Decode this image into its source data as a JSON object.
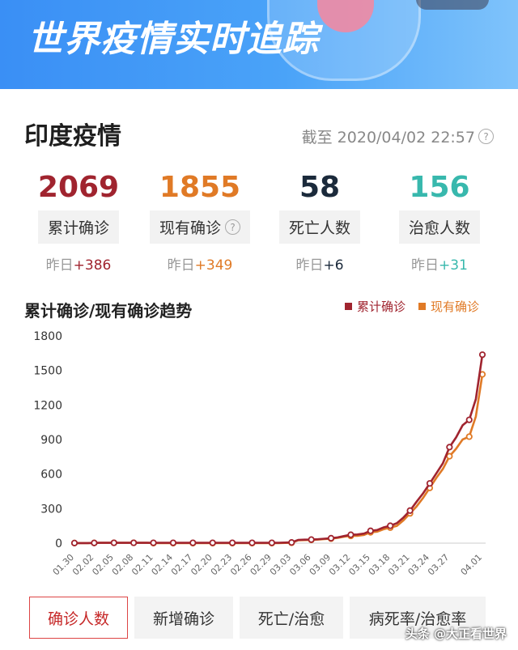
{
  "header": {
    "banner_title": "世界疫情实时追踪"
  },
  "section": {
    "title": "印度疫情",
    "as_of": "截至 2020/04/02 22:57",
    "help_glyph": "?"
  },
  "stats": [
    {
      "value": "2069",
      "label": "累计确诊",
      "delta_label": "昨日",
      "delta": "+386",
      "color": "#a0242f",
      "delta_color": "#a0242f",
      "help": false
    },
    {
      "value": "1855",
      "label": "现有确诊",
      "delta_label": "昨日",
      "delta": "+349",
      "color": "#e07a26",
      "delta_color": "#e07a26",
      "help": true
    },
    {
      "value": "58",
      "label": "死亡人数",
      "delta_label": "昨日",
      "delta": "+6",
      "color": "#1b2a3b",
      "delta_color": "#1b2a3b",
      "help": false
    },
    {
      "value": "156",
      "label": "治愈人数",
      "delta_label": "昨日",
      "delta": "+31",
      "color": "#38b8ad",
      "delta_color": "#38b8ad",
      "help": false
    }
  ],
  "chart_section": {
    "title": "累计确诊/现有确诊趋势",
    "legend": [
      {
        "name": "累计确诊",
        "color": "#a0242f"
      },
      {
        "name": "现有确诊",
        "color": "#e07a26"
      }
    ]
  },
  "chart_data": {
    "type": "line",
    "title": "累计确诊/现有确诊趋势",
    "xlabel": "",
    "ylabel": "",
    "ylim": [
      0,
      1800
    ],
    "yticks": [
      0,
      300,
      600,
      900,
      1200,
      1500,
      1800
    ],
    "grid": false,
    "legend_position": "top-right",
    "x": [
      "01.30",
      "01.31",
      "02.01",
      "02.02",
      "02.03",
      "02.04",
      "02.05",
      "02.06",
      "02.07",
      "02.08",
      "02.09",
      "02.10",
      "02.11",
      "02.12",
      "02.13",
      "02.14",
      "02.15",
      "02.16",
      "02.17",
      "02.18",
      "02.19",
      "02.20",
      "02.21",
      "02.22",
      "02.23",
      "02.24",
      "02.25",
      "02.26",
      "02.27",
      "02.28",
      "02.29",
      "03.01",
      "03.02",
      "03.03",
      "03.04",
      "03.05",
      "03.06",
      "03.07",
      "03.08",
      "03.09",
      "03.10",
      "03.11",
      "03.12",
      "03.13",
      "03.14",
      "03.15",
      "03.16",
      "03.17",
      "03.18",
      "03.19",
      "03.20",
      "03.21",
      "03.22",
      "03.23",
      "03.24",
      "03.25",
      "03.26",
      "03.27",
      "03.28",
      "03.29",
      "03.30",
      "03.31",
      "04.01"
    ],
    "tick_labels": [
      "01.30",
      "02.02",
      "02.05",
      "02.08",
      "02.11",
      "02.14",
      "02.17",
      "02.20",
      "02.23",
      "02.26",
      "02.29",
      "03.03",
      "03.06",
      "03.09",
      "03.12",
      "03.15",
      "03.18",
      "03.21",
      "03.24",
      "03.27",
      "04.01"
    ],
    "series": [
      {
        "name": "累计确诊",
        "color": "#a0242f",
        "values": [
          1,
          1,
          1,
          2,
          3,
          3,
          3,
          3,
          3,
          3,
          3,
          3,
          3,
          3,
          3,
          3,
          3,
          3,
          3,
          3,
          3,
          3,
          3,
          3,
          3,
          3,
          3,
          3,
          3,
          3,
          3,
          3,
          5,
          6,
          28,
          30,
          31,
          34,
          39,
          43,
          50,
          62,
          73,
          75,
          83,
          107,
          114,
          137,
          151,
          173,
          223,
          283,
          360,
          433,
          519,
          606,
          694,
          834,
          918,
          1024,
          1071,
          1251,
          1637
        ]
      },
      {
        "name": "现有确诊",
        "color": "#e07a26",
        "values": [
          1,
          1,
          1,
          2,
          3,
          3,
          3,
          3,
          3,
          3,
          3,
          3,
          0,
          0,
          0,
          0,
          0,
          0,
          0,
          0,
          0,
          0,
          0,
          0,
          0,
          0,
          0,
          0,
          0,
          0,
          0,
          0,
          2,
          3,
          25,
          27,
          28,
          31,
          36,
          39,
          46,
          56,
          63,
          64,
          72,
          94,
          100,
          121,
          135,
          150,
          198,
          259,
          319,
          394,
          480,
          567,
          645,
          755,
          820,
          901,
          925,
          1100,
          1466
        ]
      }
    ]
  },
  "tabs": [
    {
      "label": "确诊人数",
      "active": true
    },
    {
      "label": "新增确诊",
      "active": false
    },
    {
      "label": "死亡/治愈",
      "active": false
    },
    {
      "label": "病死率/治愈率",
      "active": false
    }
  ],
  "watermark": "头条 @大正看世界"
}
